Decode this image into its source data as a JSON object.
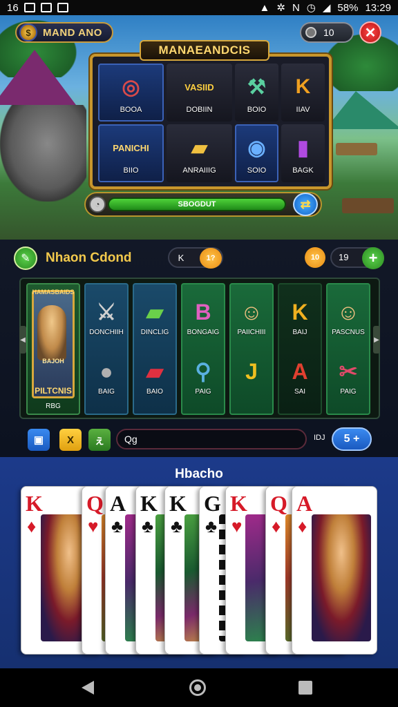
{
  "status_bar": {
    "time_left": "16",
    "battery": "58%",
    "clock": "13:29"
  },
  "header": {
    "brand": "MAND ANO",
    "coins": "10",
    "close_label": "✕"
  },
  "board": {
    "title": "MANAEANDCIS",
    "cells": [
      {
        "label": "BOOA",
        "symbol": "◎",
        "color": "#d84a4a"
      },
      {
        "label": "DOBIIN",
        "symbol": "VASIID",
        "color": "#ffd040"
      },
      {
        "label": "BOIO",
        "symbol": "⚒",
        "color": "#5ad0a0"
      },
      {
        "label": "IIAV",
        "symbol": "K",
        "color": "#f0a020"
      },
      {
        "label": "BIIO",
        "symbol": "PANICHI",
        "color": "#ffd870"
      },
      {
        "label": "ANRAIIIG",
        "symbol": "▰",
        "color": "#f0c040"
      },
      {
        "label": "SOIO",
        "symbol": "◉",
        "color": "#6ab0ff"
      },
      {
        "label": "BAGK",
        "symbol": "▮",
        "color": "#b04ae0"
      }
    ],
    "progress_text": "SBOGDUT",
    "progress_value": 1.0
  },
  "section": {
    "title": "Nhaon Cdond",
    "toggle_left": "K",
    "toggle_right": "1?",
    "badge": "10",
    "count": "19",
    "plus": "+"
  },
  "reels": {
    "feature": {
      "top": "HAMASBAIDS",
      "middle": "BAJOH",
      "bottom": "PILTCNIS",
      "label": "RBG"
    },
    "columns": [
      {
        "top": {
          "symbol": "⚔",
          "label": "DONCHIIH",
          "color": "#d0d0d0"
        },
        "bottom": {
          "symbol": "●",
          "label": "BAIG",
          "color": "#b0b0b0"
        }
      },
      {
        "top": {
          "symbol": "▰",
          "label": "DINCLIG",
          "color": "#6ad04a"
        },
        "bottom": {
          "symbol": "▰",
          "label": "BAIO",
          "color": "#e03040"
        }
      },
      {
        "top": {
          "symbol": "B",
          "label": "BONGAIG",
          "color": "#e060c0"
        },
        "bottom": {
          "symbol": "⚲",
          "label": "PAIG",
          "color": "#5ab0e0"
        }
      },
      {
        "top": {
          "symbol": "☺",
          "label": "PAIICHIII",
          "color": "#f0c080"
        },
        "bottom": {
          "symbol": "J",
          "label": "",
          "color": "#f0c020"
        }
      },
      {
        "top": {
          "symbol": "K",
          "label": "BAIJ",
          "color": "#f0b020"
        },
        "bottom": {
          "symbol": "A",
          "label": "SAI",
          "color": "#e04030"
        }
      },
      {
        "top": {
          "symbol": "☺",
          "label": "PASCNUS",
          "color": "#f0c080"
        },
        "bottom": {
          "symbol": "✂",
          "label": "PAIG",
          "color": "#e04a6a"
        }
      }
    ]
  },
  "controls": {
    "btn1": "▣",
    "btn2": "X",
    "btn3": "ぇ",
    "search_value": "Qg",
    "num": "IDJ",
    "stake": "5 +"
  },
  "hand": {
    "title": "Hbacho",
    "cards": [
      {
        "rank": "K",
        "suit": "♦",
        "color": "red",
        "art": "art-king"
      },
      {
        "rank": "Q",
        "suit": "♥",
        "color": "red",
        "art": "art-orange"
      },
      {
        "rank": "A",
        "suit": "♣",
        "color": "black",
        "art": "art-purple"
      },
      {
        "rank": "K",
        "suit": "♣",
        "color": "black",
        "art": "art-green"
      },
      {
        "rank": "K",
        "suit": "♣",
        "color": "black",
        "art": "art-green"
      },
      {
        "rank": "G",
        "suit": "♣",
        "color": "black",
        "art": "art-stripe"
      },
      {
        "rank": "K",
        "suit": "♥",
        "color": "red",
        "art": "art-purple"
      },
      {
        "rank": "Q",
        "suit": "♦",
        "color": "red",
        "art": "art-orange"
      },
      {
        "rank": "A",
        "suit": "♦",
        "color": "red",
        "art": "art-king"
      }
    ]
  }
}
